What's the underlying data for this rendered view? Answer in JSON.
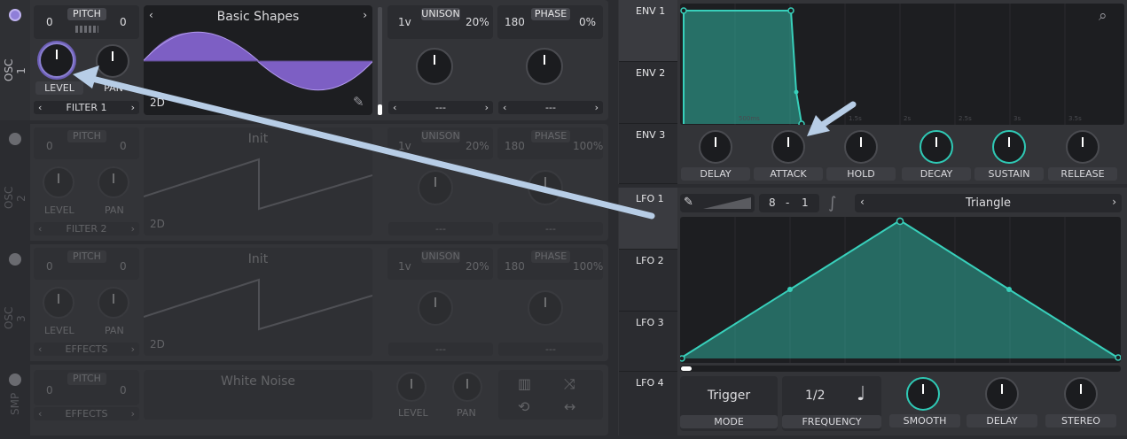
{
  "osc": [
    {
      "label": "OSC 1",
      "pitch_left": "0",
      "pitch_right": "0",
      "pitch_tag": "PITCH",
      "wave": "Basic Shapes",
      "unison_voices": "1v",
      "unison_tag": "UNISON",
      "unison_detune": "20%",
      "phase_value": "180",
      "phase_tag": "PHASE",
      "phase_rand": "0%",
      "level": "LEVEL",
      "pan": "PAN",
      "dest": "FILTER 1",
      "dim1": "---",
      "dim2": "---",
      "mode2d": "2D"
    },
    {
      "label": "OSC 2",
      "pitch_left": "0",
      "pitch_right": "0",
      "pitch_tag": "PITCH",
      "wave": "Init",
      "unison_voices": "1v",
      "unison_tag": "UNISON",
      "unison_detune": "20%",
      "phase_value": "180",
      "phase_tag": "PHASE",
      "phase_rand": "100%",
      "level": "LEVEL",
      "pan": "PAN",
      "dest": "FILTER 2",
      "dim1": "---",
      "dim2": "---",
      "mode2d": "2D"
    },
    {
      "label": "OSC 3",
      "pitch_left": "0",
      "pitch_right": "0",
      "pitch_tag": "PITCH",
      "wave": "Init",
      "unison_voices": "1v",
      "unison_tag": "UNISON",
      "unison_detune": "20%",
      "phase_value": "180",
      "phase_tag": "PHASE",
      "phase_rand": "100%",
      "level": "LEVEL",
      "pan": "PAN",
      "dest": "EFFECTS",
      "dim1": "---",
      "dim2": "---",
      "mode2d": "2D"
    }
  ],
  "smp": {
    "label": "SMP",
    "pitch_left": "0",
    "pitch_right": "0",
    "pitch_tag": "PITCH",
    "sample": "White Noise",
    "level": "LEVEL",
    "pan": "PAN",
    "dest": "EFFECTS"
  },
  "env": {
    "tabs": [
      "ENV 1",
      "ENV 2",
      "ENV 3"
    ],
    "time_labels": [
      "500ms",
      "1.5s",
      "2s",
      "2.5s",
      "3s",
      "3.5s"
    ],
    "knobs": [
      "DELAY",
      "ATTACK",
      "HOLD",
      "DECAY",
      "SUSTAIN",
      "RELEASE"
    ]
  },
  "lfo": {
    "tabs": [
      "LFO 1",
      "LFO 2",
      "LFO 3",
      "LFO 4"
    ],
    "grid_num": "8",
    "grid_sep": "-",
    "grid_den": "1",
    "shape": "Triangle",
    "trigger": "Trigger",
    "mode_label": "MODE",
    "freq": "1/2",
    "freq_label": "FREQUENCY",
    "knobs": [
      "SMOOTH",
      "DELAY",
      "STEREO"
    ]
  },
  "colors": {
    "accent": "#2fc9b5",
    "osc_wave": "#8f6fd0",
    "arrow": "#b7cde6"
  }
}
